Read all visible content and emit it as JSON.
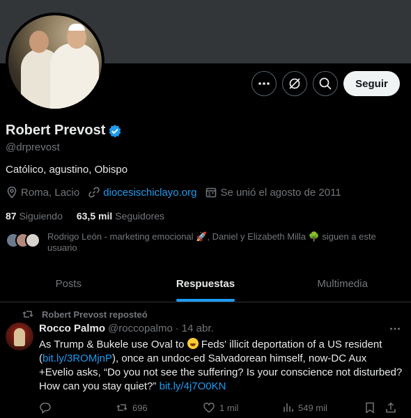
{
  "profile": {
    "name": "Robert Prevost",
    "handle": "@drprevost",
    "bio": "Católico, agustino, Obispo",
    "location": "Roma, Lacio",
    "website": "diocesischiclayo.org",
    "joined": "Se unió el agosto de 2011",
    "following_count": "87",
    "following_label": "Siguiendo",
    "followers_count": "63,5 mil",
    "followers_label": "Seguidores",
    "known_followers": "Rodrigo León - marketing emocional 🚀, Daniel y Elizabeth Milla 🌳 siguen a este usuario",
    "follow_label": "Seguir"
  },
  "tabs": [
    {
      "label": "Posts",
      "active": false
    },
    {
      "label": "Respuestas",
      "active": true
    },
    {
      "label": "Multimedia",
      "active": false
    }
  ],
  "tweet": {
    "repost_label": "Robert Prevost reposteó",
    "author_name": "Rocco Palmo",
    "author_handle": "@roccopalmo",
    "separator": "·",
    "date": "14 abr.",
    "text_1": "As Trump & Bukele use Oval to",
    "text_2": " Feds' illicit deportation of a US resident (",
    "link_1": "bit.ly/3ROMjnP",
    "text_3": "), once an undoc-ed Salvadorean himself, now-DC Aux +Evelio asks, “Do you not see the suffering? Is your conscience not disturbed? How can you stay quiet?” ",
    "link_2": "bit.ly/4j7O0KN",
    "reposts": "696",
    "likes": "1 mil",
    "views": "549 mil"
  },
  "colors": {
    "accent": "#1d9bf0",
    "muted": "#71767b",
    "text": "#e7e9ea",
    "background": "#000000",
    "banner": "#333639"
  }
}
